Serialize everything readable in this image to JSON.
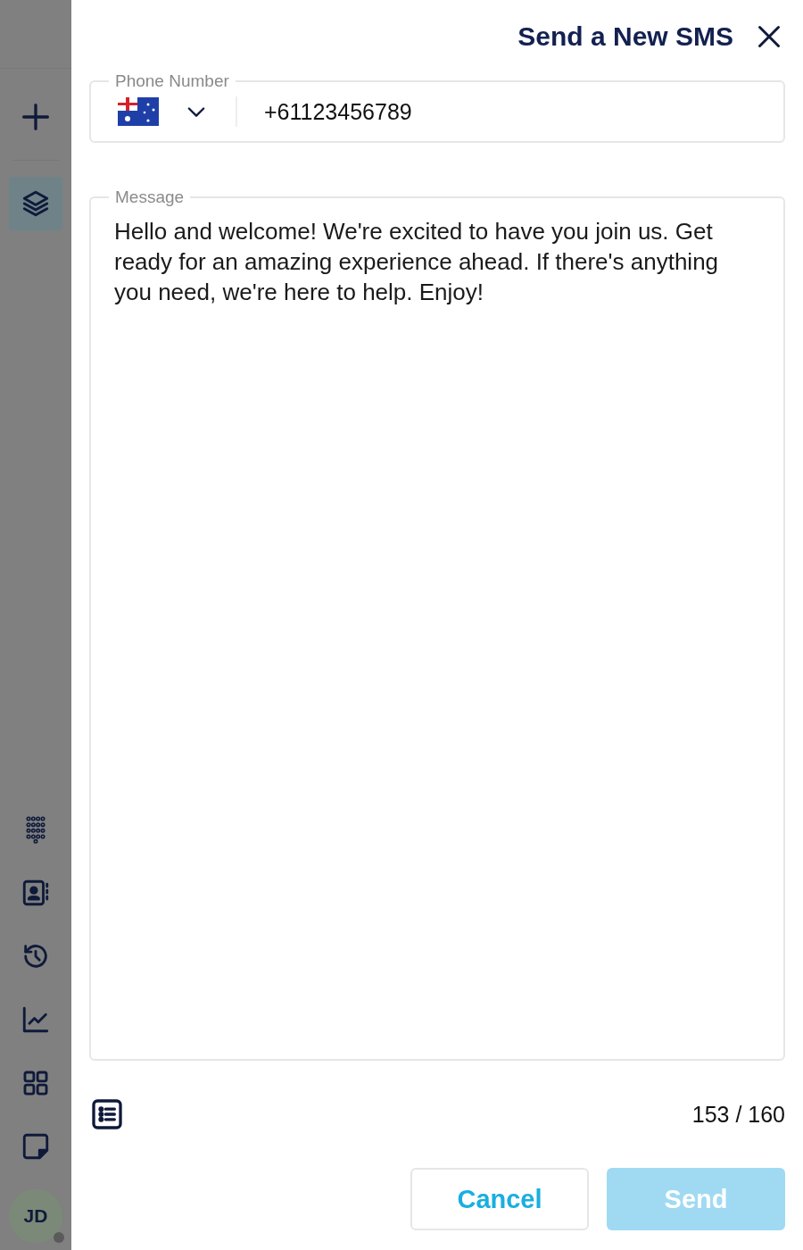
{
  "sidebar": {
    "top_items": [
      {
        "selected": false
      },
      {
        "selected": true
      }
    ],
    "bottom_items": [
      {
        "selected": false
      },
      {
        "selected": false
      },
      {
        "selected": false
      },
      {
        "selected": false
      },
      {
        "selected": false
      },
      {
        "selected": false
      }
    ],
    "avatar": {
      "initials": "JD"
    }
  },
  "dialog": {
    "title": "Send a New SMS",
    "phone": {
      "label": "Phone Number",
      "value": "+61123456789"
    },
    "message": {
      "label": "Message",
      "value": "Hello and welcome! We're excited to have you join us. Get ready for an amazing experience ahead. If there's anything you need, we're here to help. Enjoy!"
    },
    "counter": "153 / 160",
    "buttons": [
      {
        "label": "Cancel",
        "kind": "secondary",
        "disabled": false
      },
      {
        "label": "Send",
        "kind": "primary",
        "disabled": true
      }
    ]
  }
}
